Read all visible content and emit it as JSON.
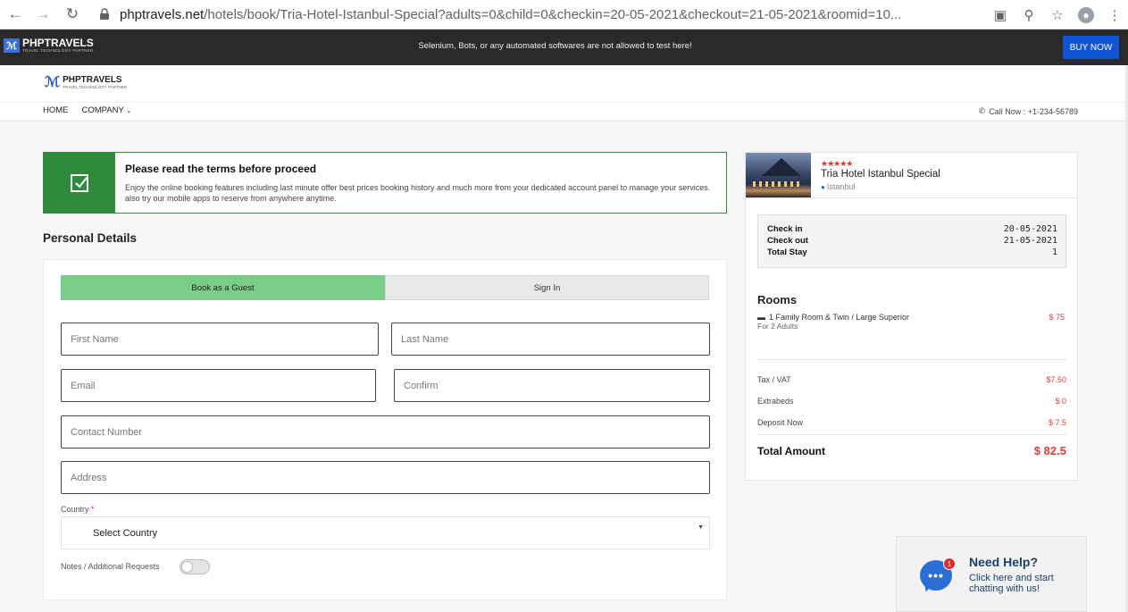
{
  "browser": {
    "url_host": "phptravels.net",
    "url_path": "/hotels/book/Tria-Hotel-Istanbul-Special?adults=0&child=0&checkin=20-05-2021&checkout=21-05-2021&roomid=10..."
  },
  "topbar": {
    "logo_text": "PHPTRAVELS",
    "logo_tagline": "TRAVEL TECHNOLOGY PARTNER",
    "warning": "Selenium, Bots, or any automated softwares are not allowed to test here!",
    "buy_now": "BUY NOW"
  },
  "header": {
    "logo_text": "PHPTRAVELS",
    "logo_tagline": "TRAVEL TECHNOLOGY PARTNER",
    "menu": [
      "HOME",
      "COMPANY"
    ],
    "call": "Call Now : +1-234-56789"
  },
  "terms": {
    "title": "Please read the terms before proceed",
    "text": "Enjoy the online booking features including last minute offer best prices booking history and much more from your dedicated account panel to manage your services. also try our mobile apps to reserve from anywhere anytime."
  },
  "personal": {
    "title": "Personal Details",
    "tab_guest": "Book as a Guest",
    "tab_signin": "Sign In",
    "first_name": "First Name",
    "last_name": "Last Name",
    "email": "Email",
    "confirm": "Confirm",
    "contact": "Contact Number",
    "address": "Address",
    "country_label": "Country",
    "country_required": "*",
    "country_value": "Select Country",
    "notes_label": "Notes / Additional Requests"
  },
  "hotel": {
    "stars": "★★★★★",
    "name": "Tria Hotel Istanbul Special",
    "location": "Istanbul"
  },
  "summary": {
    "checkin_label": "Check in",
    "checkin_value": "20-05-2021",
    "checkout_label": "Check out",
    "checkout_value": "21-05-2021",
    "stay_label": "Total Stay",
    "stay_value": "1",
    "rooms_title": "Rooms",
    "room_name": "1 Family Room & Twin / Large Superior",
    "room_sub": "For 2 Adults",
    "room_price": "$ 75",
    "tax_label": "Tax / VAT",
    "tax_value": "$7.50",
    "extrabeds_label": "Extrabeds",
    "extrabeds_value": "$ 0",
    "deposit_label": "Deposit Now",
    "deposit_value": "$ 7.5",
    "total_label": "Total Amount",
    "total_value": "$ 82.5"
  },
  "help": {
    "badge": "1",
    "title": "Need Help?",
    "text": "Click here and start chatting with us!"
  },
  "colors": {
    "accent_blue": "#1254d6",
    "terms_green": "#2f8a3b",
    "guest_tab": "#79cd86",
    "price_red": "#e03c31"
  }
}
